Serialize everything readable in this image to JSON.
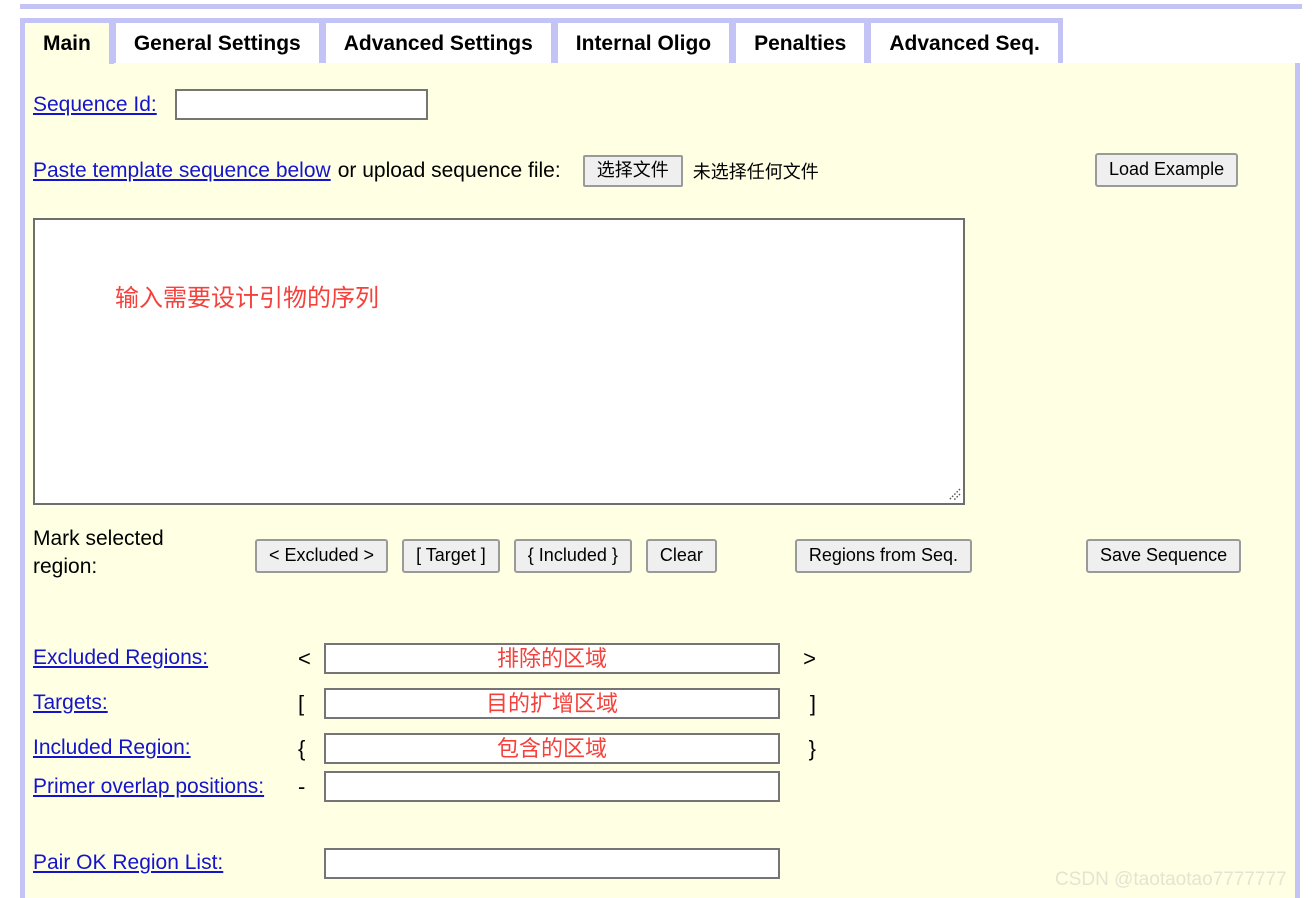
{
  "top_rule": true,
  "tabs": [
    {
      "label": "Main",
      "active": true
    },
    {
      "label": "General Settings",
      "active": false
    },
    {
      "label": "Advanced Settings",
      "active": false
    },
    {
      "label": "Internal Oligo",
      "active": false
    },
    {
      "label": "Penalties",
      "active": false
    },
    {
      "label": "Advanced Seq.",
      "active": false
    }
  ],
  "main": {
    "sequence_id": {
      "label": "Sequence Id:",
      "value": "",
      "placeholder": ""
    },
    "upload": {
      "paste_link_label": "Paste template sequence below",
      "rest_label": "or upload sequence file:",
      "choose_file_button": "选择文件",
      "file_status": "未选择任何文件",
      "load_example_button": "Load Example"
    },
    "sequence_textarea": {
      "value": "",
      "placeholder": "",
      "annotation": "输入需要设计引物的序列"
    },
    "mark_region": {
      "label_line1": "Mark selected",
      "label_line2": "region:",
      "buttons": [
        "<  Excluded  >",
        "[ Target ]",
        "{ Included }",
        "Clear",
        "Regions from Seq."
      ],
      "save_sequence_button": "Save Sequence"
    },
    "fields": [
      {
        "label": "Excluded Regions:",
        "open_bracket": "<",
        "close_bracket": ">",
        "value": "",
        "annotation": "排除的区域"
      },
      {
        "label": "Targets:",
        "open_bracket": "[",
        "close_bracket": "]",
        "value": "",
        "annotation": "目的扩增区域"
      },
      {
        "label": "Included Region:",
        "open_bracket": "{",
        "close_bracket": "}",
        "value": "",
        "annotation": "包含的区域"
      },
      {
        "label": "Primer overlap positions:",
        "open_bracket": "-",
        "close_bracket": "",
        "value": "",
        "annotation": ""
      },
      {
        "label": "Pair OK Region List:",
        "open_bracket": "",
        "close_bracket": "",
        "value": "",
        "annotation": ""
      }
    ]
  },
  "watermark": "CSDN @taotaotao7777777",
  "colors": {
    "panel_bg": "#ffffe4",
    "tab_border": "#c3c3f5",
    "link": "#1414cc",
    "annotation_red": "#f4413b",
    "button_bg": "#efefef",
    "watermark": "#e4e4d2"
  }
}
